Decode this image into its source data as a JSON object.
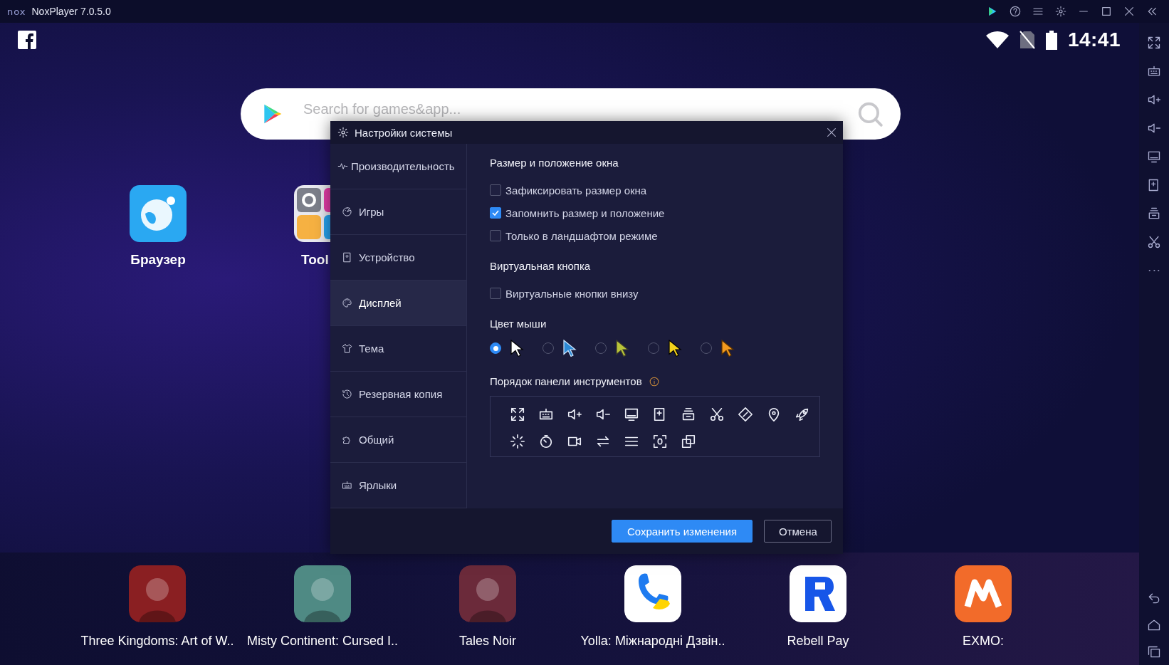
{
  "window": {
    "logo": "nox",
    "title": "NoxPlayer 7.0.5.0"
  },
  "status_bar": {
    "time": "14:41"
  },
  "search": {
    "placeholder": "Search for games&app..."
  },
  "home_apps": [
    {
      "label": "Браузер",
      "kind": "browser"
    },
    {
      "label": "Tool",
      "kind": "tools"
    }
  ],
  "dock_apps": [
    {
      "label": "Three Kingdoms: Art of W..",
      "kind": "artwork",
      "color": "#8a1f22"
    },
    {
      "label": "Misty Continent: Cursed I..",
      "kind": "artwork",
      "color": "#4f8a84"
    },
    {
      "label": "Tales Noir",
      "kind": "artwork",
      "color": "#6b2a3a"
    },
    {
      "label": "Yolla: Міжнародні Дзвін..",
      "kind": "phone",
      "color": "#ffffff"
    },
    {
      "label": "Rebell Pay",
      "kind": "fist",
      "color": "#ffffff"
    },
    {
      "label": "EXMO:",
      "kind": "zigzag",
      "color": "#f26b2a"
    }
  ],
  "settings_dialog": {
    "title": "Настройки системы",
    "nav": [
      {
        "label": "Производительность",
        "kind": "performance",
        "selected": false
      },
      {
        "label": "Игры",
        "kind": "games",
        "selected": false
      },
      {
        "label": "Устройство",
        "kind": "device",
        "selected": false
      },
      {
        "label": "Дисплей",
        "kind": "display",
        "selected": true
      },
      {
        "label": "Тема",
        "kind": "theme",
        "selected": false
      },
      {
        "label": "Резервная копия",
        "kind": "backup",
        "selected": false
      },
      {
        "label": "Общий",
        "kind": "general",
        "selected": false
      },
      {
        "label": "Ярлыки",
        "kind": "shortcuts",
        "selected": false
      }
    ],
    "window_size": {
      "heading": "Размер и положение окна",
      "options": [
        {
          "label": "Зафиксировать размер окна",
          "checked": false
        },
        {
          "label": "Запомнить размер и положение",
          "checked": true
        },
        {
          "label": "Только в ландшафтом режиме",
          "checked": false
        }
      ]
    },
    "virtual_button": {
      "heading": "Виртуальная кнопка",
      "options": [
        {
          "label": "Виртуальные кнопки внизу",
          "checked": false
        }
      ]
    },
    "mouse_color": {
      "heading": "Цвет мыши",
      "options": [
        {
          "kind": "white",
          "selected": true
        },
        {
          "kind": "blue",
          "selected": false
        },
        {
          "kind": "green",
          "selected": false
        },
        {
          "kind": "yellow",
          "selected": false
        },
        {
          "kind": "orange",
          "selected": false
        }
      ]
    },
    "toolbar_order": {
      "heading": "Порядок панели инструментов"
    },
    "buttons": [
      {
        "label": "Сохранить изменения",
        "kind": "primary"
      },
      {
        "label": "Отмена",
        "kind": "secondary"
      }
    ]
  }
}
